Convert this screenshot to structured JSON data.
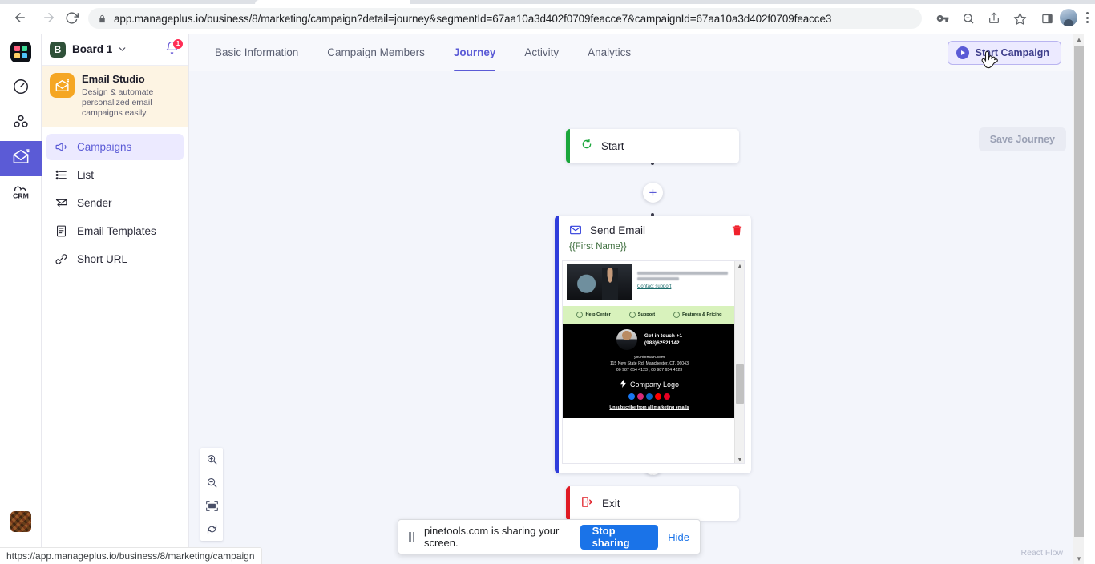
{
  "browser": {
    "url": "app.manageplus.io/business/8/marketing/campaign?detail=journey&segmentId=67aa10a3d402f0709feacce7&campaignId=67aa10a3d402f0709feacce3",
    "back_label": "Back",
    "forward_label": "Forward",
    "reload_label": "Reload",
    "status_url": "https://app.manageplus.io/business/8/marketing/campaign"
  },
  "rail": {
    "items": [
      {
        "name": "logo",
        "label": "ManagePlus"
      },
      {
        "name": "dashboard",
        "label": "Dashboard"
      },
      {
        "name": "teams",
        "label": "Teams"
      },
      {
        "name": "email-studio",
        "label": "Email Studio"
      },
      {
        "name": "crm",
        "label": "CRM"
      }
    ]
  },
  "sidebar": {
    "board_initial": "B",
    "board_name": "Board 1",
    "notification_count": "1",
    "promo": {
      "title": "Email Studio",
      "subtitle": "Design & automate personalized email campaigns easily."
    },
    "items": [
      {
        "label": "Campaigns",
        "icon": "megaphone-icon",
        "active": true
      },
      {
        "label": "List",
        "icon": "list-icon",
        "active": false
      },
      {
        "label": "Sender",
        "icon": "sender-icon",
        "active": false
      },
      {
        "label": "Email Templates",
        "icon": "template-icon",
        "active": false
      },
      {
        "label": "Short URL",
        "icon": "link-icon",
        "active": false
      }
    ]
  },
  "main": {
    "tabs": [
      {
        "label": "Basic Information",
        "active": false
      },
      {
        "label": "Campaign Members",
        "active": false
      },
      {
        "label": "Journey",
        "active": true
      },
      {
        "label": "Activity",
        "active": false
      },
      {
        "label": "Analytics",
        "active": false
      }
    ],
    "start_campaign_label": "Start Campaign",
    "save_journey_label": "Save Journey",
    "watermark": "React Flow"
  },
  "journey": {
    "nodes": [
      {
        "id": "start",
        "title": "Start",
        "icon": "refresh-circle-icon",
        "accent": "#1aa63b"
      },
      {
        "id": "send-email",
        "title": "Send Email",
        "icon": "envelope-icon",
        "accent": "#2f3ddb",
        "merge_tag": "{{First Name}}",
        "delete_label": "Delete"
      },
      {
        "id": "exit",
        "title": "Exit",
        "icon": "exit-icon",
        "accent": "#e01b24"
      }
    ],
    "add_step_label": "+",
    "zoom_controls": [
      {
        "name": "zoom-in",
        "label": "Zoom in"
      },
      {
        "name": "zoom-out",
        "label": "Zoom out"
      },
      {
        "name": "fit-view",
        "label": "Fit view"
      },
      {
        "name": "reset",
        "label": "Reset"
      }
    ]
  },
  "email_preview": {
    "hero_text_line": "performance with our powerful reporting tools.",
    "hero_link": "Contact support",
    "features": [
      {
        "label": "Help Center"
      },
      {
        "label": "Support"
      },
      {
        "label": "Features & Pricing"
      }
    ],
    "contact_line_1": "Get in touch +1",
    "contact_line_2": "(988)62521142",
    "address_domain": "yourdomain.com",
    "address_line": "115 New State Rd, Manchester, CT, 06043",
    "address_phones": "00 987 654 4123 , 00 987 654 4123",
    "company_logo_label": "Company Logo",
    "socials": [
      {
        "name": "facebook",
        "glyph": "f",
        "color": "#1877f2"
      },
      {
        "name": "instagram",
        "glyph": "◙",
        "color": "#d62976"
      },
      {
        "name": "linkedin",
        "glyph": "in",
        "color": "#0a66c2"
      },
      {
        "name": "youtube",
        "glyph": "▶",
        "color": "#ff0000"
      },
      {
        "name": "pinterest",
        "glyph": "P",
        "color": "#e60023"
      }
    ],
    "unsubscribe_label": "Unsubscribe from all marketing emails"
  },
  "share_bar": {
    "message": "pinetools.com is sharing your screen.",
    "stop_label": "Stop sharing",
    "hide_label": "Hide"
  },
  "colors": {
    "accent": "#5b5bd6",
    "start_accent": "#1aa63b",
    "exit_accent": "#e01b24",
    "email_accent": "#2f3ddb",
    "share_blue": "#1a73e8",
    "promo_bg": "#fdf4e3"
  }
}
